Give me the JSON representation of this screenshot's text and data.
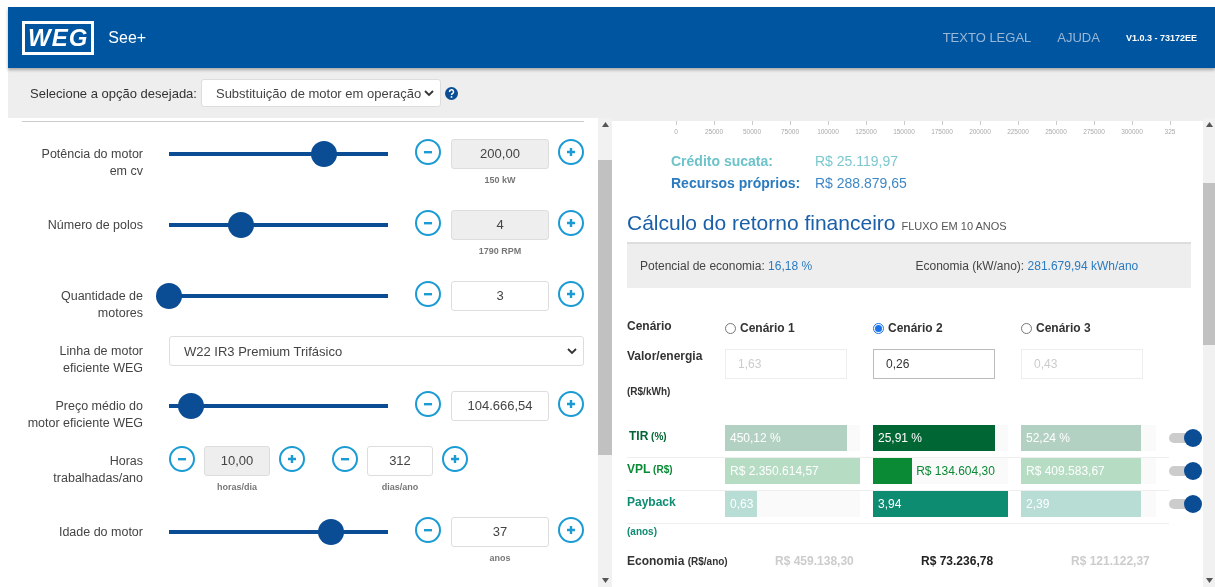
{
  "header": {
    "logo": "WEG",
    "app_name": "See+",
    "links": [
      "TEXTO LEGAL",
      "AJUDA"
    ],
    "version": "V1.0.3 - 73172EE"
  },
  "toolbar": {
    "label": "Selecione a opção desejada:",
    "select_value": "Substituição de motor em operação"
  },
  "inputs": [
    {
      "kind": "slider",
      "label": "Potência do motor em cv",
      "level": 0.71,
      "value": "200,00",
      "disabled": true,
      "unit": "150 kW"
    },
    {
      "kind": "slider",
      "label": "Número de polos",
      "level": 0.33,
      "value": "4",
      "disabled": true,
      "unit": "1790 RPM"
    },
    {
      "kind": "slider",
      "label": "Quantidade de motores",
      "level": 0,
      "value": "3",
      "disabled": false
    },
    {
      "kind": "select",
      "label": "Linha de motor eficiente WEG",
      "value": "W22 IR3 Premium Trifásico"
    },
    {
      "kind": "slider",
      "label": "Preço médio do motor eficiente WEG",
      "level": 0.1,
      "value": "104.666,54",
      "disabled": false
    },
    {
      "kind": "pair",
      "label": "Horas trabalhadas/ano",
      "fields": [
        {
          "value": "10,00",
          "disabled": true,
          "unit": "horas/dia"
        },
        {
          "value": "312",
          "disabled": false,
          "unit": "dias/ano"
        }
      ]
    },
    {
      "kind": "slider",
      "label": "Idade do motor",
      "level": 0.74,
      "value": "37",
      "disabled": false,
      "unit": "anos"
    }
  ],
  "axis_ticks": [
    "0",
    "25000",
    "50000",
    "75000",
    "100000",
    "125000",
    "150000",
    "175000",
    "200000",
    "225000",
    "250000",
    "275000",
    "300000",
    "325"
  ],
  "funding": [
    {
      "label": "Crédito sucata:",
      "value": "R$ 25.119,97",
      "color": "#6cc3c9"
    },
    {
      "label": "Recursos próprios:",
      "value": "R$ 288.879,65",
      "color": "#2a7bbf"
    }
  ],
  "section": {
    "title": "Cálculo do retorno financeiro",
    "subtitle": "FLUXO EM 10 ANOS"
  },
  "summary": [
    {
      "label": "Potencial de economia:",
      "value": "16,18 %"
    },
    {
      "label": "Economia (kW/ano):",
      "value": "281.679,94 kWh/ano"
    }
  ],
  "scenario_header": "Cenário",
  "scenarios": [
    {
      "label": "Cenário 1",
      "selected": false,
      "energy_value": "1,63",
      "economy": "R$ 459.138,30"
    },
    {
      "label": "Cenário 2",
      "selected": true,
      "energy_value": "0,26",
      "economy": "R$ 73.236,78"
    },
    {
      "label": "Cenário 3",
      "selected": false,
      "energy_value": "0,43",
      "economy": "R$ 121.122,37"
    }
  ],
  "energy_label": "Valor/energia",
  "energy_unit": "(R$/kWh)",
  "metrics": [
    {
      "name": "TIR",
      "unit": "(%)",
      "unit_below": false,
      "color": "#006633",
      "on": true,
      "values": [
        {
          "text": "450,12 %",
          "level": 0.9
        },
        {
          "text": "25,91 %",
          "level": 0.9
        },
        {
          "text": "52,24 %",
          "level": 0.89
        }
      ]
    },
    {
      "name": "VPL",
      "unit": "(R$)",
      "unit_below": false,
      "color": "#0b8a36",
      "on": true,
      "values": [
        {
          "text": "R$ 2.350.614,57",
          "level": 1
        },
        {
          "text": "R$ 134.604,30",
          "level": 0.29
        },
        {
          "text": "R$ 409.583,67",
          "level": 0.89
        }
      ]
    },
    {
      "name": "Payback",
      "unit": "(anos)",
      "unit_below": true,
      "color": "#0e8c72",
      "on": true,
      "values": [
        {
          "text": "0,63",
          "level": 0.24
        },
        {
          "text": "3,94",
          "level": 1
        },
        {
          "text": "2,39",
          "level": 0.89
        }
      ]
    }
  ],
  "economy_label": "Economia",
  "economy_unit": "(R$/ano)"
}
